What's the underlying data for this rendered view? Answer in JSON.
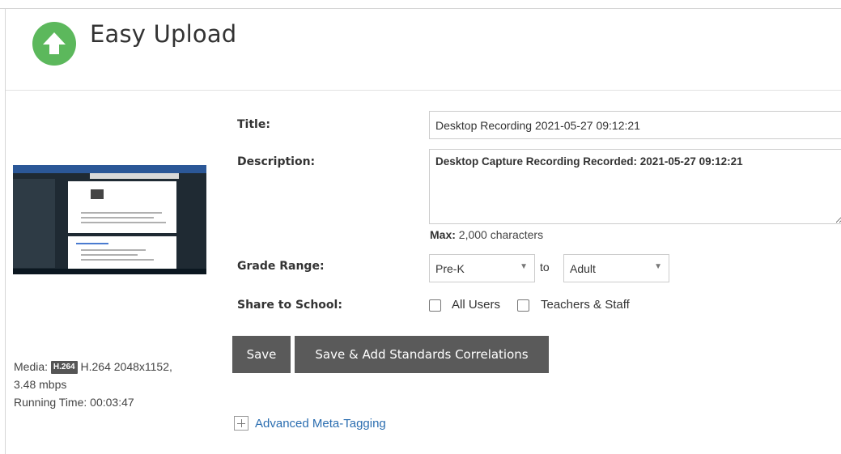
{
  "header": {
    "title": "Easy Upload",
    "icon": "upload-arrow-icon",
    "icon_color": "#5cb85c"
  },
  "media": {
    "media_label": "Media:",
    "codec_badge": "H.264",
    "codec": "H.264",
    "resolution": "2048x1152,",
    "bitrate": "3.48 mbps",
    "running_time_label": "Running Time:",
    "running_time": "00:03:47"
  },
  "form": {
    "title_label": "Title:",
    "title_value": "Desktop Recording 2021-05-27 09:12:21",
    "description_label": "Description:",
    "description_value": "Desktop Capture Recording Recorded: 2021-05-27 09:12:21",
    "max_label": "Max:",
    "max_value": "2,000 characters",
    "grade_range_label": "Grade Range:",
    "grade_from": "Pre-K",
    "grade_to_label": "to",
    "grade_to": "Adult",
    "share_label": "Share to School:",
    "share_all_users": "All Users",
    "share_teachers_staff": "Teachers & Staff"
  },
  "buttons": {
    "save": "Save",
    "save_add": "Save & Add Standards Correlations",
    "button_color": "#5a5a5a"
  },
  "advanced": {
    "label": "Advanced Meta-Tagging",
    "link_color": "#2a6db0"
  }
}
